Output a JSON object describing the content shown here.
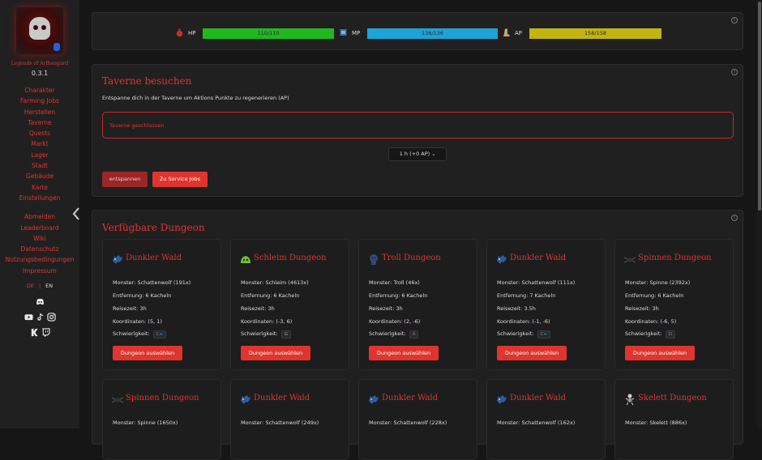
{
  "sidebar": {
    "app_name": "Legends of Arthengard",
    "version": "0.3.1",
    "nav": [
      "Charakter",
      "Farming Jobs",
      "Herstellen",
      "Taverne",
      "Quests",
      "Markt",
      "Lager",
      "Stadt",
      "Gebäude",
      "Karte",
      "Einstellungen"
    ],
    "nav2": [
      "Abmelden",
      "Leaderboard",
      "Wiki",
      "Datenschutz",
      "Nutzungsbedingungen",
      "Impressum"
    ],
    "lang": {
      "de": "DE",
      "sep": "|",
      "en": "EN"
    },
    "socials": [
      "discord-icon",
      "youtube-icon",
      "tiktok-icon",
      "instagram-icon",
      "kick-icon",
      "twitch-icon"
    ]
  },
  "stats": {
    "hp": {
      "label": "HP",
      "value": "110/110",
      "fill": 1.0,
      "color": "#1fb81f"
    },
    "mp": {
      "label": "MP",
      "value": "136/136",
      "fill": 1.0,
      "color": "#1fa2d6"
    },
    "ap": {
      "label": "AP",
      "value": "158/158",
      "fill": 1.0,
      "color": "#c2b411"
    }
  },
  "tavern": {
    "title": "Taverne besuchen",
    "description": "Entspanne dich in der Taverne um Aktions Punkte zu regenerieren (AP)",
    "alert": "Taverne geschlossen",
    "duration_select": "1 h (+0 AP)",
    "relax_button": "entspannen",
    "service_jobs_button": "Zu Service Jobs"
  },
  "dungeons": {
    "title": "Verfügbare Dungeon",
    "labels": {
      "monster": "Monster: ",
      "distance": "Entfernung: ",
      "travel": "Reisezeit: ",
      "coords": "Koordinaten: ",
      "difficulty": "Schwierigkeit: ",
      "select": "Dungeon auswählen"
    },
    "cards": [
      {
        "name": "Dunkler Wald",
        "icon": "wolf-icon",
        "monster": "Schattenwolf (191x)",
        "distance": "6 Kacheln",
        "travel": "3h",
        "coords": "(5, 1)",
        "difficulty": "C+",
        "diff_color": "#2fa7e0"
      },
      {
        "name": "Schleim Dungeon",
        "icon": "slime-icon",
        "monster": "Schleim (4613x)",
        "distance": "6 Kacheln",
        "travel": "3h",
        "coords": "(-3, 6)",
        "difficulty": "G",
        "diff_color": "#aaaaaa"
      },
      {
        "name": "Troll Dungeon",
        "icon": "troll-icon",
        "monster": "Troll (46x)",
        "distance": "6 Kacheln",
        "travel": "3h",
        "coords": "(2, -6)",
        "difficulty": "A",
        "diff_color": "#b04ad8"
      },
      {
        "name": "Dunkler Wald",
        "icon": "wolf-icon",
        "monster": "Schattenwolf (111x)",
        "distance": "7 Kacheln",
        "travel": "3.5h",
        "coords": "(-1, -6)",
        "difficulty": "C+",
        "diff_color": "#2fa7e0"
      },
      {
        "name": "Spinnen Dungeon",
        "icon": "spider-icon",
        "monster": "Spinne (2392x)",
        "distance": "6 Kacheln",
        "travel": "3h",
        "coords": "(-6, 5)",
        "difficulty": "D",
        "diff_color": "#2fa7e0"
      }
    ],
    "cards_row2": [
      {
        "name": "Spinnen Dungeon",
        "icon": "spider-icon",
        "monster": "Spinne (1650x)"
      },
      {
        "name": "Dunkler Wald",
        "icon": "wolf-icon",
        "monster": "Schattenwolf (249x)"
      },
      {
        "name": "Dunkler Wald",
        "icon": "wolf-icon",
        "monster": "Schattenwolf (228x)"
      },
      {
        "name": "Dunkler Wald",
        "icon": "wolf-icon",
        "monster": "Schattenwolf (162x)"
      },
      {
        "name": "Skelett Dungeon",
        "icon": "skeleton-icon",
        "monster": "Skelett (886x)"
      }
    ]
  }
}
